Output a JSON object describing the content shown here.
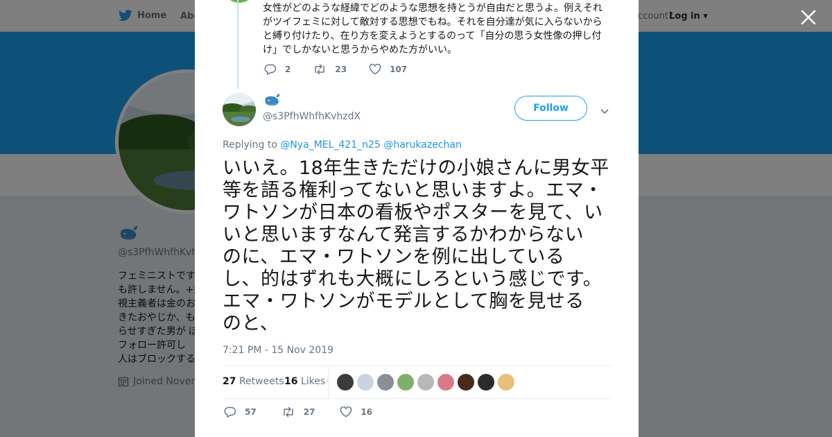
{
  "nav": {
    "home_label": "Home",
    "about_label": "Abo",
    "account_text": "ccount?",
    "login_label": "Log in"
  },
  "profile": {
    "handle": "@s3PfhWhfhKvhz",
    "bio_lines": [
      "フェミニストです",
      "も許しません。+奴",
      "視主義者は金のお",
      "きたおやじか、も",
      "らせすぎた男が ぼ",
      "フォロー許可し",
      "人はブロックする"
    ],
    "joined": "Joined Novem"
  },
  "previous_tweet": {
    "text_lines": [
      "女性がどのような経緯でどのような思想を持とうが自由だと思うよ。例えそれ",
      "がツイフェミに対して敵対する思想でもね。それを自分達が気に入らないから",
      "と縛り付けたり、在り方を変えようとするのって「自分の思う女性像の押し付",
      "け」でしかないと思うからやめた方がいい。"
    ],
    "replies": "2",
    "retweets": "23",
    "likes": "107"
  },
  "tweet": {
    "handle": "@s3PfhWhfhKvhzdX",
    "follow_label": "Follow",
    "replying_prefix": "Replying to",
    "replying_to": [
      "@Nya_MEL_421_n25",
      "@harukazechan"
    ],
    "text_lines": [
      "いいえ。18年生きただけの小娘さんに男女平",
      "等を語る権利ってないと思いますよ。エマ・",
      "ワトソンが日本の看板やポスターを見て、い",
      "いと思いますなんて発言するかわからない",
      "のに、エマ・ワトソンを例に出している",
      "し、的はずれも大概にしろという感じです。",
      "エマ・ワトソンがモデルとして胸を見せる",
      "のと、"
    ],
    "timestamp": "7:21 PM - 15 Nov 2019",
    "retweets_count": "27",
    "retweets_label": "Retweets",
    "likes_count": "16",
    "likes_label": "Likes",
    "liker_colors": [
      "#3b3b3b",
      "#c9d4e0",
      "#8a8f94",
      "#7fb069",
      "#b8b8b8",
      "#d97a8a",
      "#4a2a1a",
      "#2b2b2b",
      "#e8c07a"
    ],
    "actions": {
      "replies": "57",
      "retweets": "27",
      "likes": "16"
    }
  },
  "colors": {
    "brand": "#1da1f2",
    "link": "#1b95e0",
    "muted": "#657786"
  }
}
